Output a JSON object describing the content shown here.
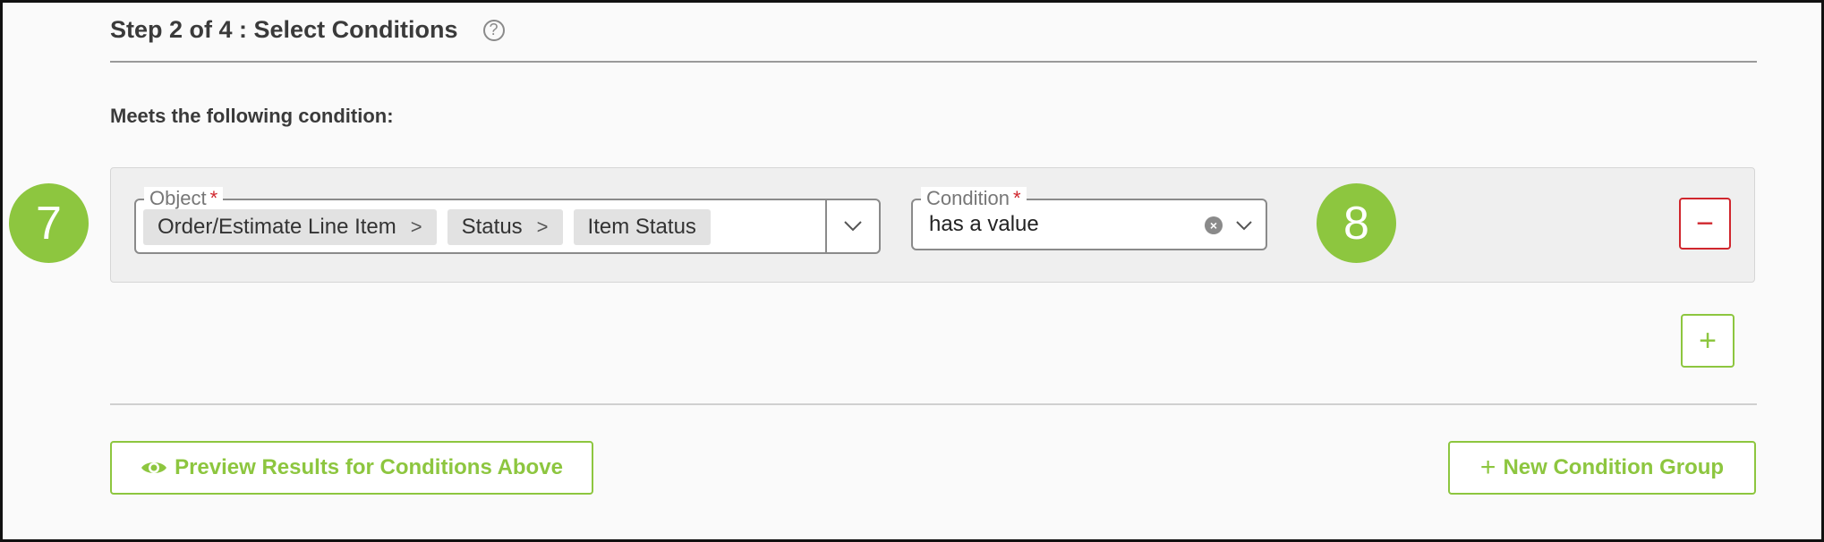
{
  "header": {
    "step_title": "Step 2 of 4 : Select Conditions",
    "help_glyph": "?"
  },
  "subtitle": "Meets the following condition:",
  "badges": {
    "left": "7",
    "right": "8"
  },
  "object_field": {
    "label": "Object",
    "required_mark": "*",
    "chips": [
      {
        "label": "Order/Estimate Line Item",
        "separator": ">"
      },
      {
        "label": "Status",
        "separator": ">"
      },
      {
        "label": "Item Status"
      }
    ]
  },
  "condition_field": {
    "label": "Condition",
    "required_mark": "*",
    "value": "has a value",
    "clear_glyph": "×"
  },
  "actions": {
    "remove_glyph": "−",
    "add_glyph": "+",
    "preview_label": "Preview Results for Conditions Above",
    "new_group_glyph": "+",
    "new_group_label": "New Condition Group"
  },
  "colors": {
    "accent_green": "#8dc63f",
    "danger_red": "#d0262d",
    "panel_bg": "#efefef"
  }
}
